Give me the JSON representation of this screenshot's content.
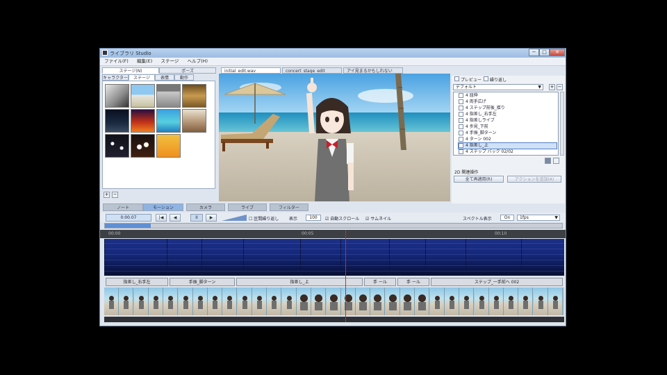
{
  "window": {
    "title": "ライブラリ Studio",
    "controls": [
      "─",
      "□",
      "✕"
    ]
  },
  "menu": [
    "ファイル(F)",
    "編集(E)",
    "ステージ",
    "ヘルプ(H)"
  ],
  "left_panel": {
    "tabs": [
      "ステージ(N)",
      "ポーズ"
    ],
    "subtabs": [
      "キャラクター",
      "ステージ",
      "表情",
      "動作"
    ],
    "add_label": "+",
    "remove_label": "−"
  },
  "document_tabs": [
    "initial_edit.wav",
    "concert_stage_edit",
    "アイ見まるかもしれない"
  ],
  "right_panel": {
    "checks": [
      "プレビュー",
      "繰り返し"
    ],
    "dropdown_value": "デフォルト",
    "tracks": [
      "4 屈伸",
      "4 両手広げ",
      "4 ステップ前後_揺り",
      "4 指差し_右手左",
      "4 指差しライブ",
      "4 歩見_下前",
      "4 手振_脚ターン",
      "4 ターン 002",
      "4 指差し_上",
      "4 ステップ バック 02/02"
    ],
    "selected_index": 8,
    "section_label": "2D 関連操作",
    "button_left": "全て再適用(R)",
    "button_right": "アクションを追加(A)"
  },
  "mode_tabs": [
    "ノート",
    "モーション",
    "カメラ",
    "ライブ",
    "フィルター"
  ],
  "active_mode": 1,
  "toolbar": {
    "time_label": "0:00.07",
    "buttons": [
      "|◀",
      "◀",
      "II",
      "▶"
    ],
    "checkbox_a": "区間繰り返し",
    "view_label": "表示",
    "zoom_value": "100",
    "checkbox_b": "自動スクロール",
    "checkbox_c": "サムネイル",
    "spectral_label": "スペクトル表示",
    "spectral_value": "On",
    "speed_value": "1fps"
  },
  "progress_percent": 10,
  "ruler_labels": [
    "00:00",
    "00:05",
    "00:10"
  ],
  "segments": [
    "指差し_右手左",
    "手振_脚ターン",
    "指差し_上",
    "手 ール",
    "手 ール",
    "ステップ_一手前へ 002"
  ],
  "colors": {
    "frame": "#6e86a8",
    "accent": "#5f8fd4",
    "spectrogram": "#16287a",
    "playhead": "#e02020"
  }
}
